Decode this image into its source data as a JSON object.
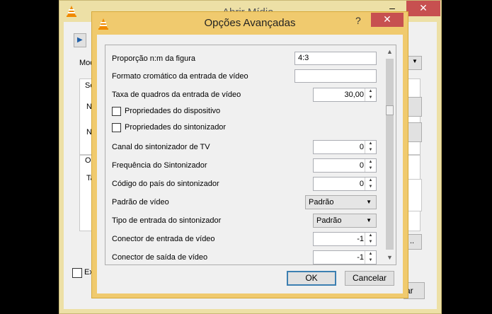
{
  "parent_window": {
    "title": "Abrir Mídia",
    "minimize": "–",
    "close": "✕",
    "ghost_labels": [
      "Moc",
      "Se",
      "N",
      "N",
      "O",
      "Ta"
    ],
    "checkbox_label": "Ex",
    "partial_button": "ar",
    "ellipsis_button": ".."
  },
  "dialog": {
    "title": "Opções Avançadas",
    "help": "?",
    "close": "✕",
    "settings": [
      {
        "label": "Proporção n:m da figura",
        "type": "text",
        "value": "4:3"
      },
      {
        "label": "Formato cromático da entrada de vídeo",
        "type": "text",
        "value": ""
      },
      {
        "label": "Taxa de quadros da entrada de vídeo",
        "type": "spin",
        "value": "30,00"
      },
      {
        "label": "Propriedades do dispositivo",
        "type": "checkbox",
        "checked": false
      },
      {
        "label": "Propriedades do sintonizador",
        "type": "checkbox",
        "checked": false
      },
      {
        "label": "Canal do sintonizador de TV",
        "type": "spin",
        "value": "0"
      },
      {
        "label": "Frequência do Sintonizador",
        "type": "spin",
        "value": "0"
      },
      {
        "label": "Código do país do sintonizador",
        "type": "spin",
        "value": "0"
      },
      {
        "label": "Padrão de vídeo",
        "type": "combo",
        "value": "Padrão"
      },
      {
        "label": "Tipo de entrada do sintonizador",
        "type": "combo",
        "value": "Padrão"
      },
      {
        "label": "Conector de entrada de vídeo",
        "type": "spin",
        "value": "-1"
      },
      {
        "label": "Conector de saída de vídeo",
        "type": "spin",
        "value": "-1"
      }
    ],
    "ok_label": "OK",
    "cancel_label": "Cancelar"
  },
  "colors": {
    "dialog_frame": "#f0ca6e",
    "parent_frame": "#ede0a6",
    "close_button": "#c75050",
    "default_button_border": "#3c7fb1"
  },
  "icons": [
    "vlc-cone-icon",
    "play-icon",
    "spin-up-icon",
    "spin-down-icon",
    "dropdown-arrow-icon",
    "scroll-up-icon",
    "scroll-down-icon"
  ]
}
